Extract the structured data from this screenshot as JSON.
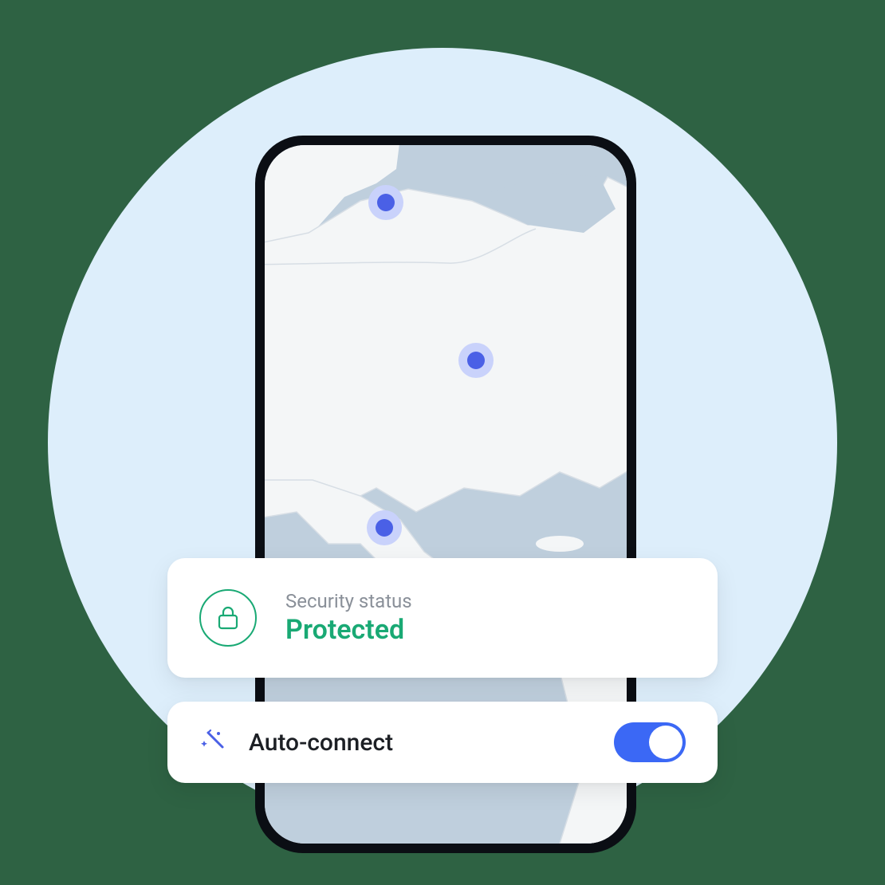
{
  "status": {
    "label": "Security status",
    "value": "Protected"
  },
  "auto_connect": {
    "label": "Auto-connect",
    "enabled": true
  },
  "colors": {
    "accent_green": "#19a974",
    "accent_blue": "#3b68f5",
    "marker_blue": "#4a60e6"
  },
  "map": {
    "markers": [
      {
        "name": "marker-north"
      },
      {
        "name": "marker-central"
      },
      {
        "name": "marker-south"
      }
    ]
  }
}
